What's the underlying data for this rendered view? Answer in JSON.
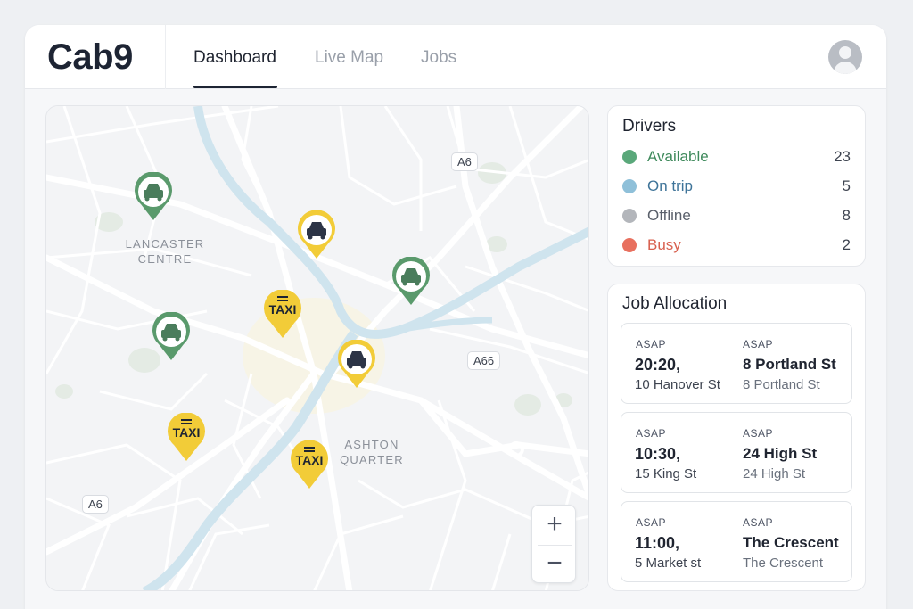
{
  "app": {
    "logo": "Cab9"
  },
  "nav": {
    "tabs": [
      {
        "label": "Dashboard",
        "active": true
      },
      {
        "label": "Live Map",
        "active": false
      },
      {
        "label": "Jobs",
        "active": false
      }
    ],
    "avatar_icon": "user-avatar-icon"
  },
  "map": {
    "areas": [
      {
        "line1": "LANCASTER",
        "line2": "CENTRE"
      },
      {
        "line1": "ASHTON",
        "line2": "QUARTER"
      }
    ],
    "road_tags": [
      "A6",
      "A66",
      "A6"
    ],
    "pins": [
      {
        "kind": "available",
        "icon": "car-icon",
        "color": "#5a9a6c"
      },
      {
        "kind": "on-trip",
        "icon": "car-icon",
        "color": "#f2cc38"
      },
      {
        "kind": "available",
        "icon": "car-icon",
        "color": "#5a9a6c"
      },
      {
        "kind": "taxi",
        "label": "TAXI",
        "color": "#f2cc38"
      },
      {
        "kind": "available",
        "icon": "car-icon",
        "color": "#5a9a6c"
      },
      {
        "kind": "on-trip",
        "icon": "car-icon",
        "color": "#f2cc38"
      },
      {
        "kind": "taxi",
        "label": "TAXI",
        "color": "#f2cc38"
      },
      {
        "kind": "taxi",
        "label": "TAXI",
        "color": "#f2cc38"
      }
    ],
    "zoom_in": "+",
    "zoom_out": "−"
  },
  "drivers": {
    "title": "Drivers",
    "rows": [
      {
        "label": "Available",
        "count": "23",
        "color": "#5aa87a",
        "text_color": "#3f8a5c"
      },
      {
        "label": "On trip",
        "count": "5",
        "color": "#8fc0d9",
        "text_color": "#3f7499"
      },
      {
        "label": "Offline",
        "count": "8",
        "color": "#b3b6bb",
        "text_color": "#5a606b"
      },
      {
        "label": "Busy",
        "count": "2",
        "color": "#e8705f",
        "text_color": "#d8604f"
      }
    ]
  },
  "jobs": {
    "title": "Job Allocation",
    "items": [
      {
        "tag_left": "ASAP",
        "tag_right": "ASAP",
        "time": "20:20,",
        "pickup": "10 Hanover St",
        "dest": "8 Portland St",
        "dest_sub": "8 Portland St"
      },
      {
        "tag_left": "ASAP",
        "tag_right": "ASAP",
        "time": "10:30,",
        "pickup": "15 King St",
        "dest": "24 High St",
        "dest_sub": "24 High St"
      },
      {
        "tag_left": "ASAP",
        "tag_right": "ASAP",
        "time": "11:00,",
        "pickup": "5 Market st",
        "dest": "The Crescent",
        "dest_sub": "The Crescent"
      }
    ]
  }
}
